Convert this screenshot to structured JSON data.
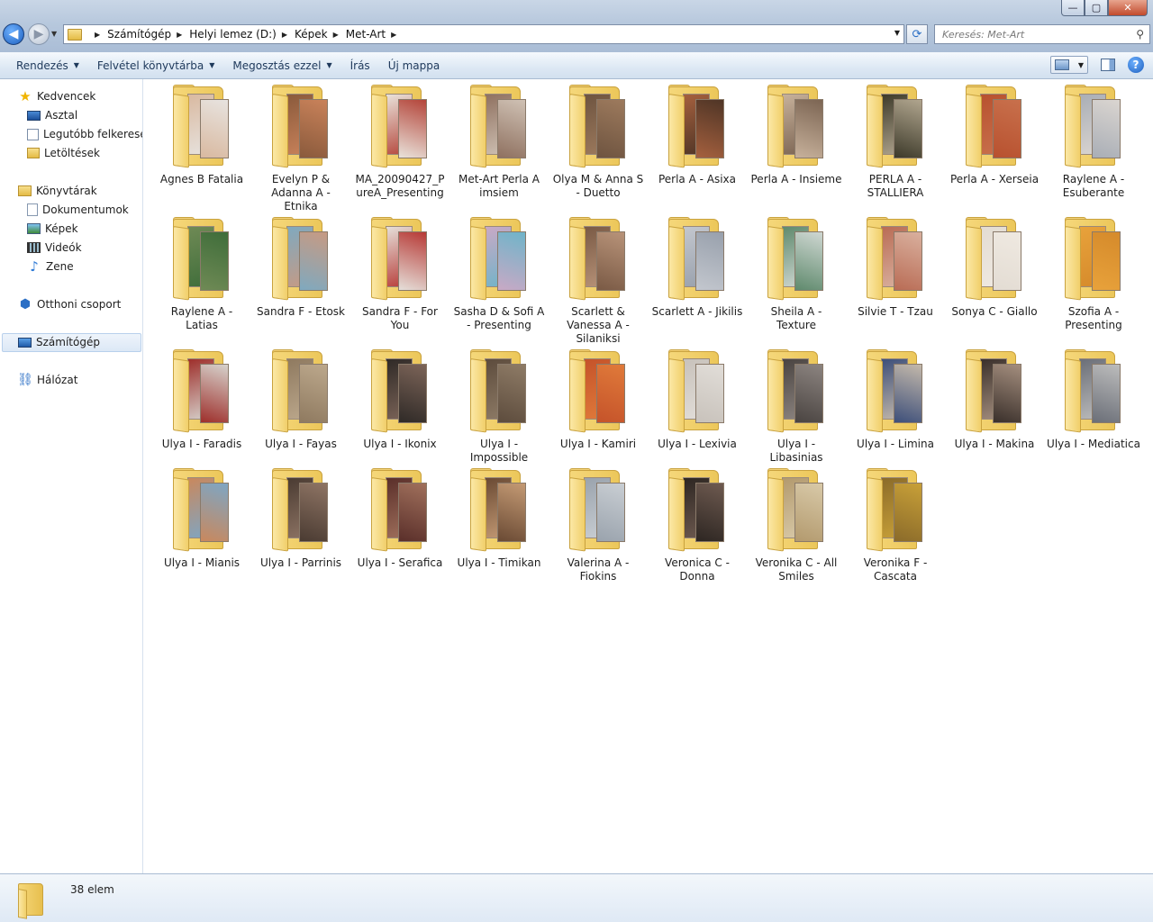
{
  "window": {
    "min_label": "—",
    "max_label": "▢",
    "close_label": "✕"
  },
  "address": {
    "crumbs": [
      "Számítógép",
      "Helyi lemez (D:)",
      "Képek",
      "Met-Art"
    ]
  },
  "search": {
    "placeholder": "Keresés: Met-Art"
  },
  "toolbar": {
    "items": [
      {
        "label": "Rendezés",
        "dropdown": true
      },
      {
        "label": "Felvétel könyvtárba",
        "dropdown": true
      },
      {
        "label": "Megosztás ezzel",
        "dropdown": true
      },
      {
        "label": "Írás",
        "dropdown": false
      },
      {
        "label": "Új mappa",
        "dropdown": false
      }
    ]
  },
  "sidebar": {
    "items": [
      {
        "label": "Kedvencek",
        "icon": "star-icon"
      },
      {
        "label": "Asztal",
        "icon": "desktop-icon"
      },
      {
        "label": "Legutóbb felkeresett",
        "icon": "recent-places-icon"
      },
      {
        "label": "Letöltések",
        "icon": "downloads-icon"
      },
      {
        "label": "Könyvtárak",
        "icon": "libraries-icon"
      },
      {
        "label": "Dokumentumok",
        "icon": "documents-icon"
      },
      {
        "label": "Képek",
        "icon": "pictures-icon"
      },
      {
        "label": "Videók",
        "icon": "videos-icon"
      },
      {
        "label": "Zene",
        "icon": "music-icon"
      },
      {
        "label": "Otthoni csoport",
        "icon": "homegroup-icon"
      },
      {
        "label": "Számítógép",
        "icon": "computer-icon"
      },
      {
        "label": "Hálózat",
        "icon": "network-icon"
      }
    ],
    "selected": "Számítógép"
  },
  "folders": [
    {
      "name": "Agnes B Fatalia",
      "c1": "#d9b9a0",
      "c2": "#e7e3df"
    },
    {
      "name": "Evelyn P & Adanna A - Etnika",
      "c1": "#8a5a3c",
      "c2": "#c9825a"
    },
    {
      "name": "MA_20090427_PureA_Presenting",
      "c1": "#e9e2da",
      "c2": "#b4453a"
    },
    {
      "name": "Met-Art Perla A imsiem",
      "c1": "#8f7160",
      "c2": "#cfc1b4"
    },
    {
      "name": "Olya M & Anna S - Duetto",
      "c1": "#6e5440",
      "c2": "#9d7a5d"
    },
    {
      "name": "Perla A - Asixa",
      "c1": "#a5603e",
      "c2": "#4f3526"
    },
    {
      "name": "Perla A - Insieme",
      "c1": "#c7b19b",
      "c2": "#7c6553"
    },
    {
      "name": "PERLA A - STALLIERA",
      "c1": "#3d3a2a",
      "c2": "#b0a58e"
    },
    {
      "name": "Perla A - Xerseia",
      "c1": "#b8512f",
      "c2": "#c8704c"
    },
    {
      "name": "Raylene A - Esuberante",
      "c1": "#a9aeb6",
      "c2": "#dad5d0"
    },
    {
      "name": "Raylene A - Latias",
      "c1": "#6f8a55",
      "c2": "#3f6d3a"
    },
    {
      "name": "Sandra F - Etosk",
      "c1": "#7fa9bf",
      "c2": "#c79a83"
    },
    {
      "name": "Sandra F - For You",
      "c1": "#e5dfd9",
      "c2": "#b73a36"
    },
    {
      "name": "Sasha D & Sofi A - Presenting",
      "c1": "#c9a9c5",
      "c2": "#6fb4c9"
    },
    {
      "name": "Scarlett & Vanessa A - Silaniksi",
      "c1": "#7a5a45",
      "c2": "#b89379"
    },
    {
      "name": "Scarlett A - Jikilis",
      "c1": "#c3c7ce",
      "c2": "#98a0ac"
    },
    {
      "name": "Sheila A - Texture",
      "c1": "#5f8a6d",
      "c2": "#cfd7d2"
    },
    {
      "name": "Silvie T - Tzau",
      "c1": "#b96c55",
      "c2": "#d9b09e"
    },
    {
      "name": "Sonya C - Giallo",
      "c1": "#e3dcd3",
      "c2": "#efe9e1"
    },
    {
      "name": "Szofia A - Presenting",
      "c1": "#e8a23b",
      "c2": "#d58a2b"
    },
    {
      "name": "Ulya I - Faradis",
      "c1": "#9e2f2b",
      "c2": "#d6d2cc"
    },
    {
      "name": "Ulya I - Fayas",
      "c1": "#8f7a60",
      "c2": "#bca88c"
    },
    {
      "name": "Ulya I - Ikonix",
      "c1": "#2f2a27",
      "c2": "#7c6458"
    },
    {
      "name": "Ulya I - Impossible",
      "c1": "#5d4c3d",
      "c2": "#8e7b66"
    },
    {
      "name": "Ulya I - Kamiri",
      "c1": "#c5532a",
      "c2": "#e07a3a"
    },
    {
      "name": "Ulya I - Lexivia",
      "c1": "#c8c2bb",
      "c2": "#e1ddd8"
    },
    {
      "name": "Ulya I - Libasinias",
      "c1": "#4a4441",
      "c2": "#8c8480"
    },
    {
      "name": "Ulya I - Limina",
      "c1": "#3d4f7a",
      "c2": "#c4b9ab"
    },
    {
      "name": "Ulya I - Makina",
      "c1": "#3a302b",
      "c2": "#a48e7e"
    },
    {
      "name": "Ulya I - Mediatica",
      "c1": "#6b6f78",
      "c2": "#bcbcbc"
    },
    {
      "name": "Ulya I - Mianis",
      "c1": "#c9885d",
      "c2": "#7ea6c4"
    },
    {
      "name": "Ulya I - Parrinis",
      "c1": "#4a3b32",
      "c2": "#8e7464"
    },
    {
      "name": "Ulya I - Serafica",
      "c1": "#5a2f2a",
      "c2": "#a0705c"
    },
    {
      "name": "Ulya I - Timikan",
      "c1": "#6a4a34",
      "c2": "#c49a74"
    },
    {
      "name": "Valerina A - Fiokins",
      "c1": "#9aa3ad",
      "c2": "#c9ced3"
    },
    {
      "name": "Veronica C - Donna",
      "c1": "#2d2622",
      "c2": "#6e5a50"
    },
    {
      "name": "Veronika C - All Smiles",
      "c1": "#b39a6e",
      "c2": "#d8c9a8"
    },
    {
      "name": "Veronika F - Cascata",
      "c1": "#8b6b2a",
      "c2": "#c8a038"
    }
  ],
  "status": {
    "count_text": "38 elem"
  }
}
